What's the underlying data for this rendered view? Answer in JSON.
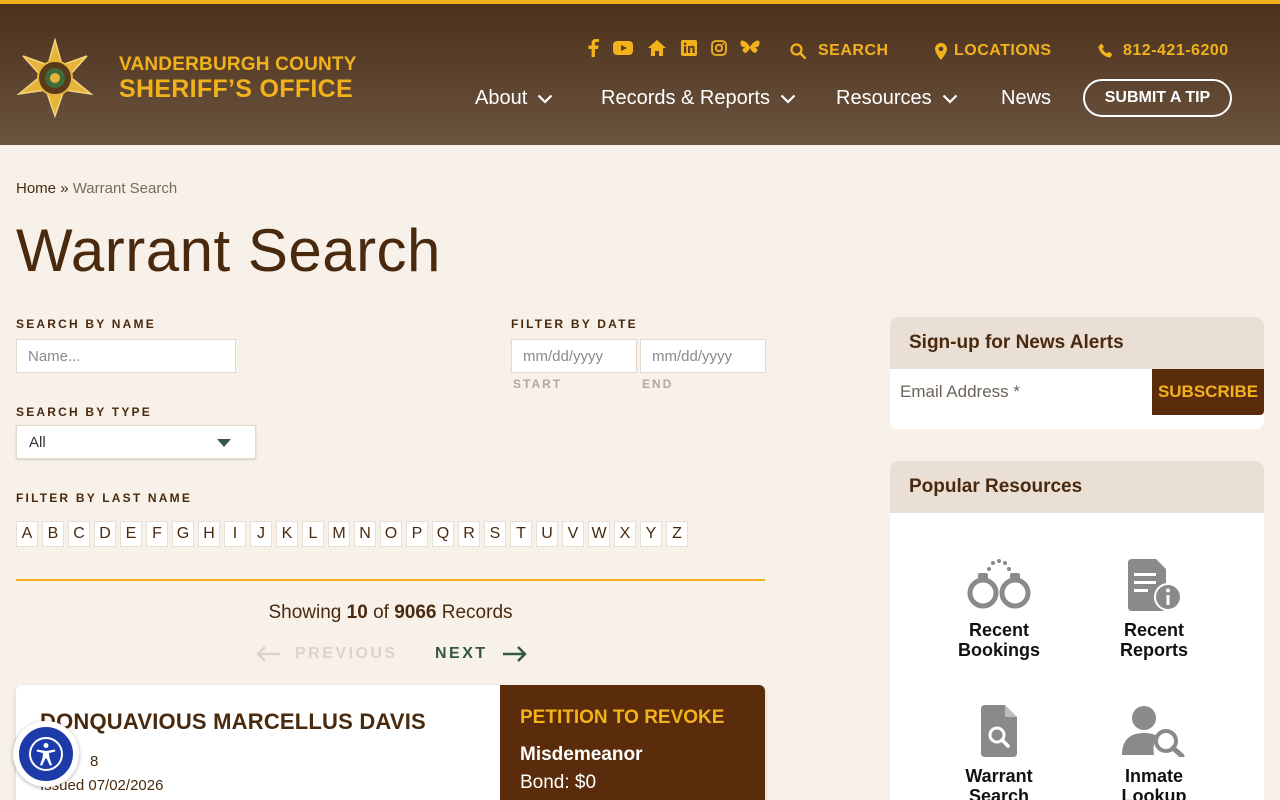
{
  "header": {
    "logo_line1": "VANDERBURGH COUNTY",
    "logo_line2": "SHERIFF’S OFFICE",
    "search_label": "SEARCH",
    "locations_label": "LOCATIONS",
    "phone": "812-421-6200",
    "nav": [
      {
        "label": "About"
      },
      {
        "label": "Records & Reports"
      },
      {
        "label": "Resources"
      },
      {
        "label": "News"
      }
    ],
    "tip_button": "SUBMIT A TIP",
    "social_icons": [
      "facebook-icon",
      "youtube-icon",
      "home-icon",
      "linkedin-icon",
      "instagram-icon",
      "bluesky-icon"
    ]
  },
  "breadcrumb": {
    "home": "Home",
    "separator": "»",
    "current": "Warrant Search"
  },
  "page_title": "Warrant Search",
  "filters": {
    "name_label": "SEARCH BY NAME",
    "name_placeholder": "Name...",
    "date_label": "FILTER BY DATE",
    "start_placeholder": "mm/dd/yyyy",
    "end_placeholder": "mm/dd/yyyy",
    "start_label": "START",
    "end_label": "END",
    "type_label": "SEARCH BY TYPE",
    "type_value": "All",
    "lastname_label": "FILTER BY LAST NAME",
    "letters": [
      "A",
      "B",
      "C",
      "D",
      "E",
      "F",
      "G",
      "H",
      "I",
      "J",
      "K",
      "L",
      "M",
      "N",
      "O",
      "P",
      "Q",
      "R",
      "S",
      "T",
      "U",
      "V",
      "W",
      "X",
      "Y",
      "Z"
    ]
  },
  "results": {
    "showing_prefix": "Showing",
    "count": "10",
    "of": "of",
    "total": "9066",
    "records": "Records",
    "previous": "PREVIOUS",
    "next": "NEXT"
  },
  "card": {
    "name": "DONQUAVIOUS MARCELLUS DAVIS",
    "id_fragment": "8",
    "issued": "Issued 07/02/2026",
    "type": "PETITION TO REVOKE",
    "level": "Misdemeanor",
    "bond": "Bond: $0"
  },
  "sidebar": {
    "alerts_title": "Sign-up for News Alerts",
    "email_placeholder": "Email Address *",
    "subscribe": "SUBSCRIBE",
    "resources_title": "Popular Resources",
    "resources": [
      {
        "line1": "Recent",
        "line2": "Bookings",
        "icon": "handcuffs-icon"
      },
      {
        "line1": "Recent",
        "line2": "Reports",
        "icon": "report-info-icon"
      },
      {
        "line1": "Warrant",
        "line2": "Search",
        "icon": "document-search-icon"
      },
      {
        "line1": "Inmate",
        "line2": "Lookup",
        "icon": "person-search-icon"
      }
    ]
  },
  "colors": {
    "brand_gold": "#f2b21c",
    "brand_brown": "#5b2c0b",
    "accent_green": "#355744",
    "access_blue": "#1c3ba8"
  }
}
